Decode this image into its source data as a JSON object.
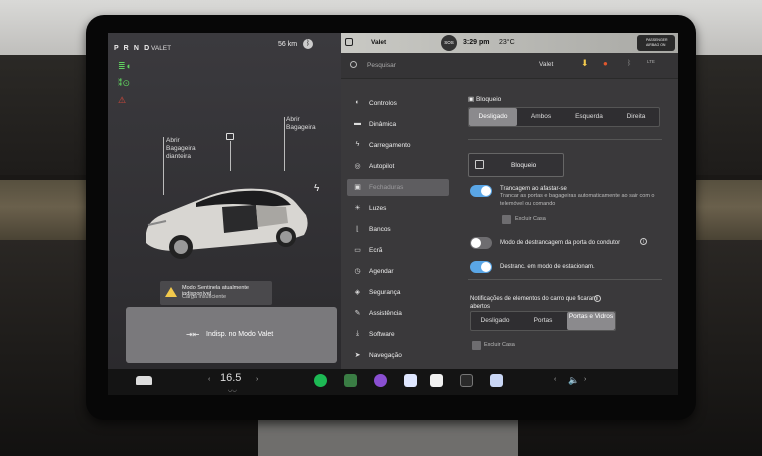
{
  "top_left": {
    "gears": "P R N D",
    "valet": "VALET",
    "range": "56 km"
  },
  "car_panel": {
    "front_trunk": "Abrir\nBagageira\ndianteira",
    "rear_trunk": "Abrir\nBagageira",
    "warning_line1": "Modo Sentinela atualmente indisponível",
    "warning_line2": "Carga insuficiente",
    "valet_button": "Indisp. no Modo Valet"
  },
  "status_bar": {
    "valet": "Valet",
    "speed_limit": "SOS",
    "time": "3:29 pm",
    "temperature": "23°C",
    "airbag": "PASSENGER AIRBAG ON"
  },
  "search": {
    "placeholder": "Pesquisar",
    "valet": "Valet",
    "network": "LTE"
  },
  "nav": [
    {
      "label": "Controlos",
      "icon": "toggle-icon"
    },
    {
      "label": "Dinâmica",
      "icon": "car-icon"
    },
    {
      "label": "Carregamento",
      "icon": "bolt-icon"
    },
    {
      "label": "Autopilot",
      "icon": "steering-wheel-icon"
    },
    {
      "label": "Fechaduras",
      "icon": "lock-icon",
      "active": true
    },
    {
      "label": "Luzes",
      "icon": "sun-icon"
    },
    {
      "label": "Bancos",
      "icon": "seat-icon"
    },
    {
      "label": "Ecrã",
      "icon": "display-icon"
    },
    {
      "label": "Agendar",
      "icon": "clock-icon"
    },
    {
      "label": "Segurança",
      "icon": "shield-icon"
    },
    {
      "label": "Assistência",
      "icon": "wrench-icon"
    },
    {
      "label": "Software",
      "icon": "download-icon"
    },
    {
      "label": "Navegação",
      "icon": "navigation-icon"
    }
  ],
  "locks": {
    "title": "Bloqueio",
    "segments": [
      "Desligado",
      "Ambos",
      "Esquerda",
      "Direita"
    ],
    "selected_segment": "Desligado",
    "lock_button": "Bloqueio",
    "walk_away_title": "Trancagem ao afastar-se",
    "walk_away_desc": "Trancar as portas e bagageiras automaticamente ao sair com o telemóvel ou comando",
    "walk_away_on": true,
    "exclude_home": "Excluir Casa",
    "driver_door_title": "Modo de destrancagem da porta do condutor",
    "driver_door_on": false,
    "park_unlock_title": "Destranc. em modo de estacionam.",
    "park_unlock_on": true,
    "notifications_title": "Notificações de elementos do carro que ficaram abertos",
    "notif_segments": [
      "Desligado",
      "Portas",
      "Portas e Vidros"
    ],
    "notif_selected": "Portas e Vidros",
    "exclude_home2": "Excluir Casa"
  },
  "dock": {
    "temperature": "16.5",
    "heat_icons": "◡◡"
  }
}
